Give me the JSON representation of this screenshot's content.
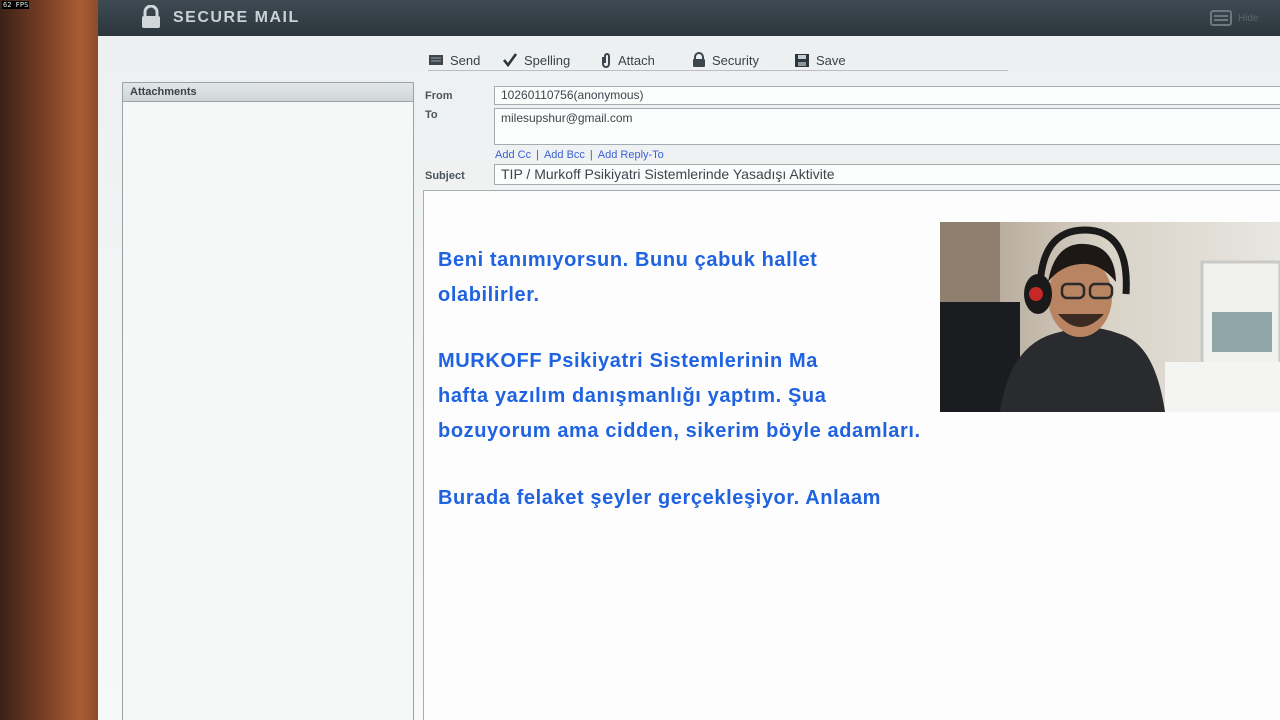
{
  "overlay": {
    "fps": "62 FPS"
  },
  "window": {
    "title": "SECURE MAIL",
    "corner_label": "Hide"
  },
  "toolbar": {
    "items": [
      {
        "label": "Send",
        "icon": "send-icon"
      },
      {
        "label": "Spelling",
        "icon": "check-icon"
      },
      {
        "label": "Attach",
        "icon": "paperclip-icon"
      },
      {
        "label": "Security",
        "icon": "lock-icon"
      },
      {
        "label": "Save",
        "icon": "floppy-disk-icon"
      }
    ]
  },
  "attachments": {
    "header": "Attachments"
  },
  "compose": {
    "from_label": "From",
    "from_value": "10260110756(anonymous)",
    "to_label": "To",
    "to_value": "milesupshur@gmail.com",
    "add_cc": "Add Cc",
    "add_bcc": "Add Bcc",
    "add_reply_to": "Add Reply-To",
    "subject_label": "Subject",
    "subject_value": "TIP / Murkoff Psikiyatri Sistemlerinde Yasadışı Aktivite"
  },
  "message": {
    "lines": [
      "Beni tanımıyorsun. Bunu çabuk hallet",
      "olabilirler.",
      "MURKOFF Psikiyatri Sistemlerinin Ma",
      "hafta yazılım danışmanlığı yaptım. Şua",
      "bozuyorum ama cidden, sikerim böyle adamları.",
      "Burada felaket şeyler gerçekleşiyor. Anlaam"
    ]
  },
  "colors": {
    "titlebar": "#2c363d",
    "message_text": "#1f63e0",
    "link": "#3a5fd6"
  }
}
